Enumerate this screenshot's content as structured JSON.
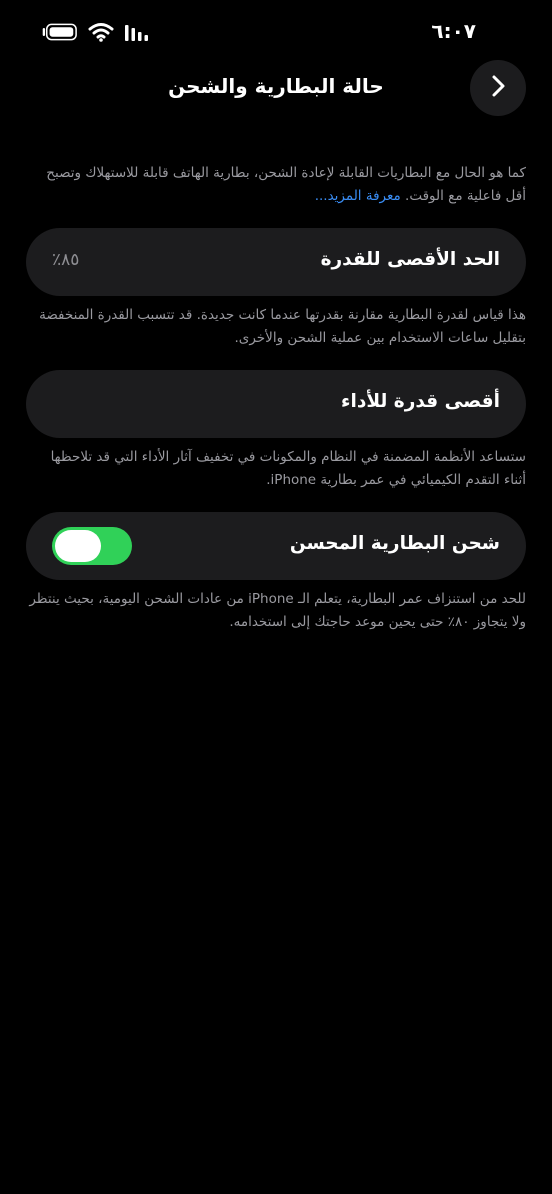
{
  "status_bar": {
    "time": "٦:٠٧",
    "battery_icon": "battery-icon",
    "wifi_icon": "wifi-icon",
    "signal_icon": "signal-icon"
  },
  "nav": {
    "title": "حالة البطارية والشحن",
    "back_icon": "chevron-right-icon"
  },
  "intro": {
    "text": "كما هو الحال مع البطاريات القابلة لإعادة الشحن، بطارية الهاتف قابلة للاستهلاك وتصبح أقل فاعلية مع الوقت. ",
    "link": "معرفة المزيد..."
  },
  "maximum_capacity": {
    "label": "الحد الأقصى للقدرة",
    "value": "٨٥٪",
    "footnote": "هذا قياس لقدرة البطارية مقارنة بقدرتها عندما كانت جديدة. قد تتسبب القدرة المنخفضة بتقليل ساعات الاستخدام بين عملية الشحن والأخرى."
  },
  "peak_performance": {
    "label": "أقصى قدرة للأداء",
    "footnote": "ستساعد الأنظمة المضمنة في النظام والمكونات في تخفيف آثار الأداء التي قد تلاحظها أثناء التقدم الكيميائي في عمر بطارية iPhone."
  },
  "optimized_charging": {
    "label": "شحن البطارية المحسن",
    "enabled": true,
    "toggle_color": "#30d158",
    "footnote": "للحد من استنزاف عمر البطارية، يتعلم الـ iPhone من عادات الشحن اليومية، بحيث ينتظر ولا يتجاوز ٨٠٪ حتى يحين موعد حاجتك إلى استخدامه."
  },
  "colors": {
    "background": "#000000",
    "card": "#1c1c1e",
    "secondary_text": "#9a9aa0",
    "link": "#3a8ef6"
  }
}
